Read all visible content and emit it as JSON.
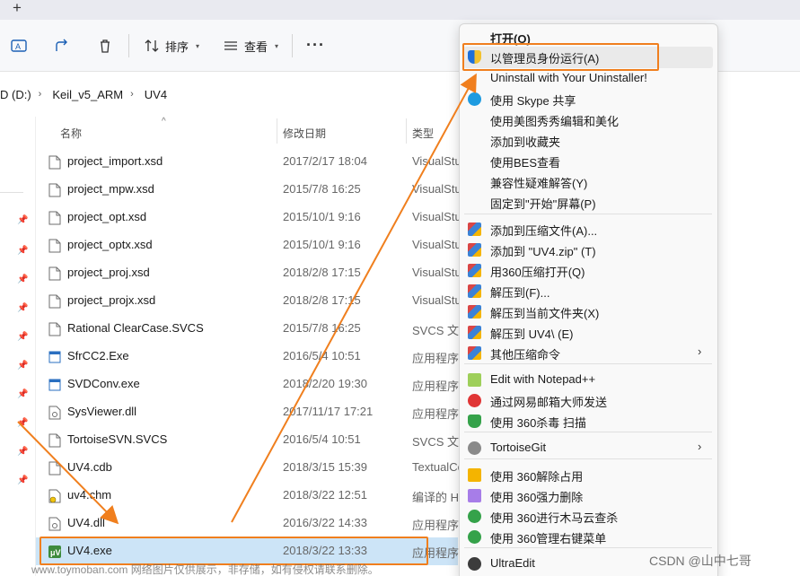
{
  "toolbar": {
    "sort_label": "排序",
    "view_label": "查看",
    "more_label": "···"
  },
  "address": {
    "crumbs": [
      "D (D:)",
      "Keil_v5_ARM",
      "UV4"
    ]
  },
  "columns": {
    "name": "名称",
    "date": "修改日期",
    "type": "类型"
  },
  "files": [
    {
      "name": "project_import.xsd",
      "date": "2017/2/17 18:04",
      "type": "VisualStu",
      "icon": "file-icon"
    },
    {
      "name": "project_mpw.xsd",
      "date": "2015/7/8 16:25",
      "type": "VisualStu",
      "icon": "file-icon"
    },
    {
      "name": "project_opt.xsd",
      "date": "2015/10/1 9:16",
      "type": "VisualStu",
      "icon": "file-icon"
    },
    {
      "name": "project_optx.xsd",
      "date": "2015/10/1 9:16",
      "type": "VisualStu",
      "icon": "file-icon"
    },
    {
      "name": "project_proj.xsd",
      "date": "2018/2/8 17:15",
      "type": "VisualStu",
      "icon": "file-icon"
    },
    {
      "name": "project_projx.xsd",
      "date": "2018/2/8 17:15",
      "type": "VisualStu",
      "icon": "file-icon"
    },
    {
      "name": "Rational ClearCase.SVCS",
      "date": "2015/7/8 16:25",
      "type": "SVCS 文件",
      "icon": "file-icon"
    },
    {
      "name": "SfrCC2.Exe",
      "date": "2016/5/4 10:51",
      "type": "应用程序",
      "icon": "exe-icon"
    },
    {
      "name": "SVDConv.exe",
      "date": "2018/2/20 19:30",
      "type": "应用程序",
      "icon": "exe-icon"
    },
    {
      "name": "SysViewer.dll",
      "date": "2017/11/17 17:21",
      "type": "应用程序扩",
      "icon": "dll-icon"
    },
    {
      "name": "TortoiseSVN.SVCS",
      "date": "2016/5/4 10:51",
      "type": "SVCS 文件",
      "icon": "file-icon"
    },
    {
      "name": "UV4.cdb",
      "date": "2018/3/15 15:39",
      "type": "TextualCo",
      "icon": "file-icon"
    },
    {
      "name": "uv4.chm",
      "date": "2018/3/22 12:51",
      "type": "编译的 HT",
      "icon": "chm-icon"
    },
    {
      "name": "UV4.dll",
      "date": "2016/3/22 14:33",
      "type": "应用程序扩",
      "icon": "dll-icon"
    },
    {
      "name": "UV4.exe",
      "date": "2018/3/22 13:33",
      "type": "应用程序",
      "icon": "uv4-exe-icon",
      "selected": true
    }
  ],
  "menu": {
    "items": [
      {
        "label": "打开(O)",
        "bold": true,
        "icon": ""
      },
      {
        "label": "以管理员身份运行(A)",
        "icon": "uac-shield-icon"
      },
      {
        "label": "Uninstall with Your Uninstaller!",
        "icon": ""
      },
      {
        "label": "使用 Skype 共享",
        "icon": "skype-icon"
      },
      {
        "label": "使用美图秀秀编辑和美化",
        "icon": ""
      },
      {
        "label": "添加到收藏夹",
        "icon": ""
      },
      {
        "label": "使用BES查看",
        "icon": ""
      },
      {
        "label": "兼容性疑难解答(Y)",
        "icon": ""
      },
      {
        "label": "固定到\"开始\"屏幕(P)",
        "icon": ""
      },
      {
        "label": "添加到压缩文件(A)...",
        "icon": "archive-icon"
      },
      {
        "label": "添加到 \"UV4.zip\" (T)",
        "icon": "archive-icon"
      },
      {
        "label": "用360压缩打开(Q)",
        "icon": "archive-icon"
      },
      {
        "label": "解压到(F)...",
        "icon": "archive-icon"
      },
      {
        "label": "解压到当前文件夹(X)",
        "icon": "archive-icon"
      },
      {
        "label": "解压到 UV4\\ (E)",
        "icon": "archive-icon"
      },
      {
        "label": "其他压缩命令",
        "icon": "archive-icon",
        "submenu": true
      },
      {
        "label": "Edit with Notepad++",
        "icon": "notepadpp-icon"
      },
      {
        "label": "通过网易邮箱大师发送",
        "icon": "netease-mail-icon"
      },
      {
        "label": "使用 360杀毒 扫描",
        "icon": "360-antivirus-icon"
      },
      {
        "label": "TortoiseGit",
        "icon": "tortoisegit-icon",
        "submenu": true
      },
      {
        "label": "使用 360解除占用",
        "icon": "360-unlock-icon"
      },
      {
        "label": "使用 360强力删除",
        "icon": "360-delete-icon"
      },
      {
        "label": "使用 360进行木马云查杀",
        "icon": "360-trojan-icon"
      },
      {
        "label": "使用 360管理右键菜单",
        "icon": "360-menu-icon"
      },
      {
        "label": "UltraEdit",
        "icon": "ultraedit-icon"
      }
    ]
  },
  "colors": {
    "accent_orange": "#f07f1e",
    "selection": "#cce4f7"
  },
  "watermark": {
    "left": "www.toymoban.com 网络图片仅供展示，非存储，如有侵权请联系删除。",
    "right": "CSDN @山中七哥"
  }
}
